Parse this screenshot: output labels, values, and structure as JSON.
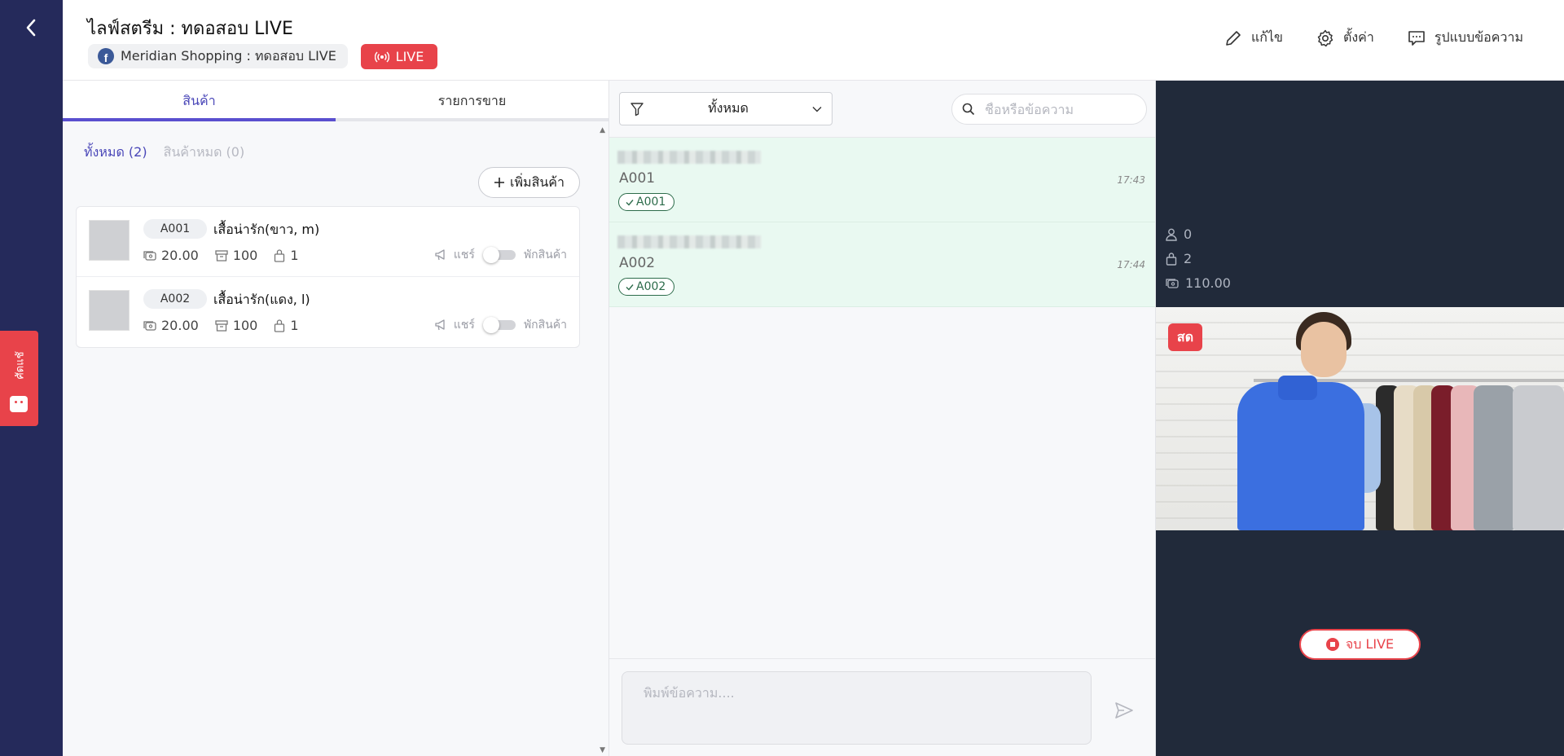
{
  "header": {
    "title": "ไลฟ์สตรีม : ทดอสอบ LIVE",
    "page_label": "Meridian Shopping : ทดอสอบ LIVE",
    "live_label": "LIVE",
    "actions": {
      "edit": "แก้ไข",
      "settings": "ตั้งค่า",
      "message_format": "รูปแบบข้อความ"
    }
  },
  "sidebar": {
    "chat_tab_label": "ศัดแชั"
  },
  "products": {
    "tabs": [
      "สินค้า",
      "รายการขาย"
    ],
    "filters": {
      "all": "ทั้งหมด (2)",
      "out_of_stock": "สินค้าหมด (0)"
    },
    "add_button": "เพิ่มสินค้า",
    "items": [
      {
        "sku": "A001",
        "name": "เสื้อน่ารัก(ขาว, m)",
        "price": "20.00",
        "stock": "100",
        "sold": "1",
        "share": "แชร์",
        "pause": "พักสินค้า"
      },
      {
        "sku": "A002",
        "name": "เสื้อน่ารัก(แดง, l)",
        "price": "20.00",
        "stock": "100",
        "sold": "1",
        "share": "แชร์",
        "pause": "พักสินค้า"
      }
    ]
  },
  "comments": {
    "filter_value": "ทั้งหมด",
    "search_placeholder": "ชื่อหรือข้อความ",
    "items": [
      {
        "text": "A001",
        "time": "17:43",
        "tag": "A001"
      },
      {
        "text": "A002",
        "time": "17:44",
        "tag": "A002"
      }
    ],
    "composer_placeholder": "พิมพ์ข้อความ...."
  },
  "live": {
    "viewers": "0",
    "orders": "2",
    "revenue": "110.00",
    "live_tag": "สด",
    "end_button": "จบ LIVE"
  },
  "colors": {
    "rail": "#252a5b",
    "accent": "#5a4fcf",
    "live_red": "#e8434a",
    "comment_bg": "#e9f9f1",
    "tag_green": "#2d6c4b",
    "dark_panel": "#212a3a"
  }
}
